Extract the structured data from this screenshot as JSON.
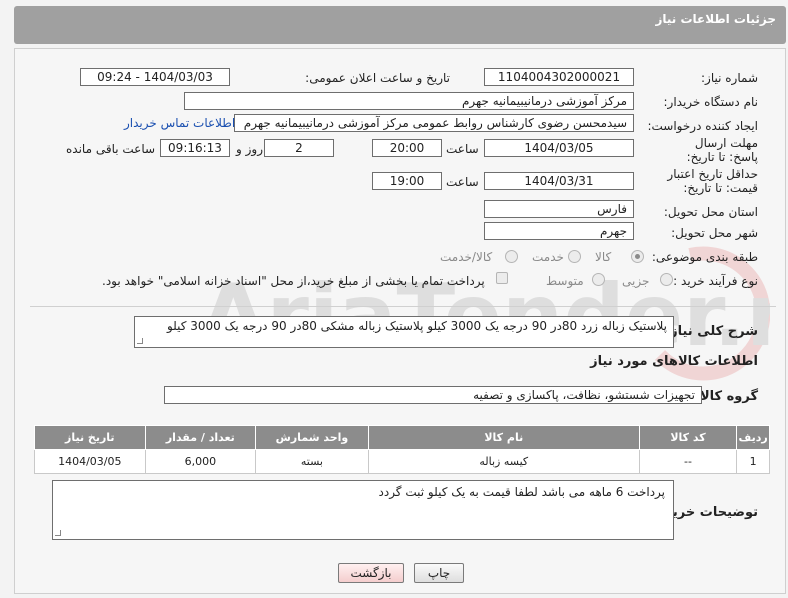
{
  "header": {
    "title": "جزئیات اطلاعات نیاز"
  },
  "form": {
    "need_number_label": "شماره نیاز:",
    "need_number": "1104004302000021",
    "announce_label": "تاریخ و ساعت اعلان عمومی:",
    "announce_value": "1404/03/03 - 09:24",
    "buyer_org_label": "نام دستگاه خریدار:",
    "buyer_org": "مرکز آموزشی درمانیبیمانیه جهرم",
    "creator_label": "ایجاد کننده درخواست:",
    "creator": "سیدمحسن رضوی کارشناس روابط عمومی مرکز آموزشی درمانیبیمانیه جهرم",
    "contact_link": "اطلاعات تماس خریدار",
    "deadline_label": "مهلت ارسال پاسخ: تا تاریخ:",
    "deadline_date": "1404/03/05",
    "time_label": "ساعت",
    "deadline_time": "20:00",
    "days_value": "2",
    "days_label": "روز و",
    "remaining_time": "09:16:13",
    "remaining_label": "ساعت باقی مانده",
    "price_validity_label": "حداقل تاریخ اعتبار قیمت: تا تاریخ:",
    "price_validity_date": "1404/03/31",
    "price_validity_time": "19:00",
    "province_label": "استان محل تحویل:",
    "province": "فارس",
    "city_label": "شهر محل تحویل:",
    "city": "جهرم",
    "category_label": "طبقه بندی موضوعی:",
    "category_options": [
      "کالا",
      "خدمت",
      "کالا/خدمت"
    ],
    "process_label": "نوع فرآیند خرید :",
    "process_options": [
      "جزیی",
      "متوسط"
    ],
    "treasury_note": "پرداخت تمام یا بخشی از مبلغ خرید،از محل \"اسناد خزانه اسلامی\" خواهد بود.",
    "description_label": "شرح کلی نیاز:",
    "description": "پلاستیک زباله زرد 80در 90 درجه یک 3000 کیلو پلاستیک زباله مشکی 80در 90  درجه یک 3000 کیلو",
    "goods_info_title": "اطلاعات کالاهای مورد نیاز",
    "goods_group_label": "گروه کالا:",
    "goods_group": "تجهیزات شستشو، نظافت، پاکسازی و تصفیه",
    "buyer_notes_label": "توضیحات خریدار:",
    "buyer_notes": "پرداخت 6 ماهه می باشد  لطفا قیمت به یک کیلو ثبت گردد"
  },
  "table": {
    "headers": [
      "ردیف",
      "کد کالا",
      "نام کالا",
      "واحد شمارش",
      "تعداد / مقدار",
      "تاریخ نیاز"
    ],
    "rows": [
      [
        "1",
        "--",
        "کیسه زباله",
        "بسته",
        "6,000",
        "1404/03/05"
      ]
    ]
  },
  "buttons": {
    "print": "چاپ",
    "back": "بازگشت"
  },
  "watermark_text": "AriaTender.neT"
}
